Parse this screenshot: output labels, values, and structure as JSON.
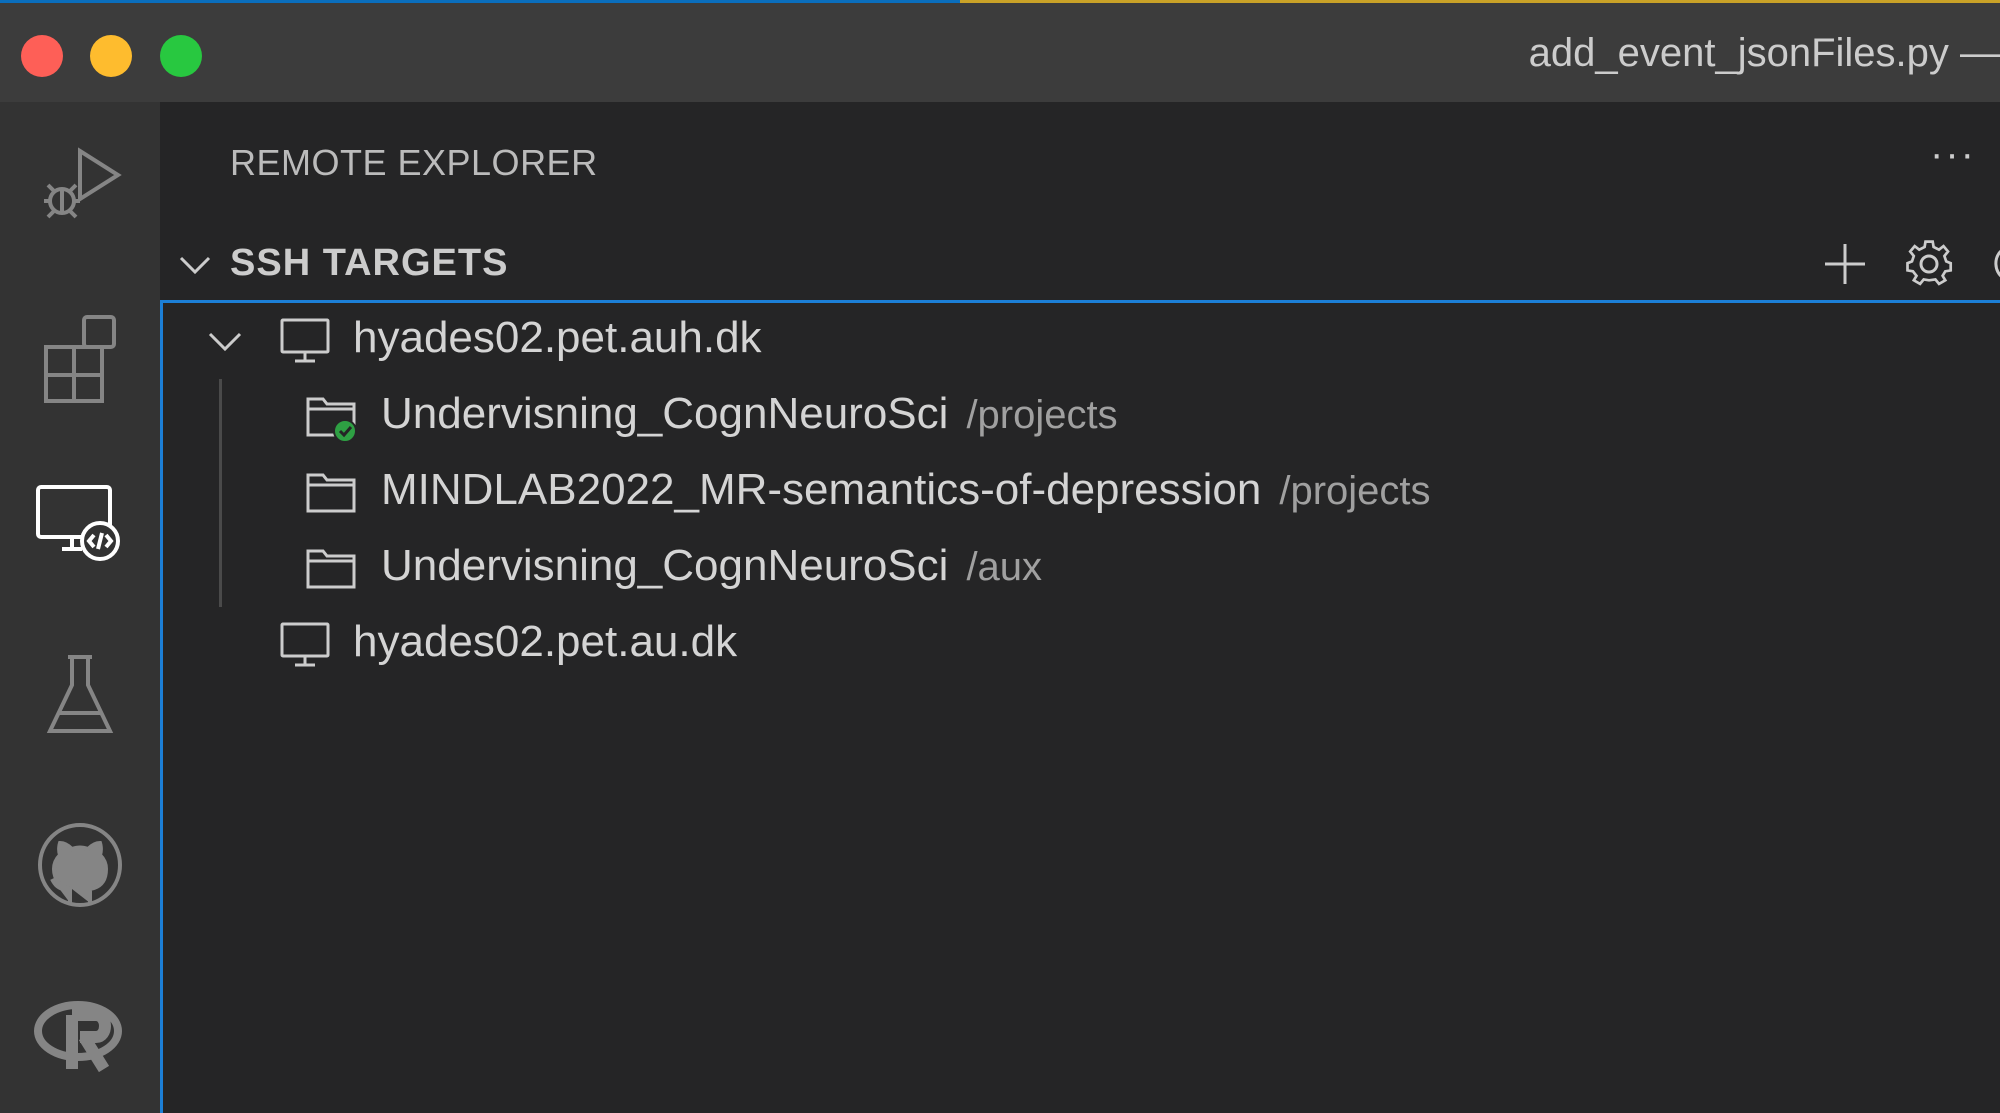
{
  "window": {
    "title": "add_event_jsonFiles.py —"
  },
  "activity_bar": {
    "items": [
      {
        "name": "Run and Debug",
        "icon": "run-debug-icon",
        "active": false
      },
      {
        "name": "Extensions",
        "icon": "extensions-icon",
        "active": false
      },
      {
        "name": "Remote Explorer",
        "icon": "remote-explorer-icon",
        "active": true
      },
      {
        "name": "Testing",
        "icon": "flask-icon",
        "active": false
      },
      {
        "name": "GitHub",
        "icon": "github-icon",
        "active": false
      },
      {
        "name": "R",
        "icon": "r-icon",
        "active": false
      }
    ]
  },
  "sidebar": {
    "title": "REMOTE EXPLORER",
    "more_actions": "···",
    "section": {
      "title": "SSH TARGETS",
      "actions": [
        "plus-icon",
        "gear-icon",
        "refresh-icon"
      ]
    },
    "tree": [
      {
        "host": "hyades02.pet.auh.dk",
        "expanded": true,
        "folders": [
          {
            "name": "Undervisning_CognNeuroSci",
            "path": "/projects",
            "connected": true
          },
          {
            "name": "MINDLAB2022_MR-semantics-of-depression",
            "path": "/projects",
            "connected": false
          },
          {
            "name": "Undervisning_CognNeuroSci",
            "path": "/aux",
            "connected": false
          }
        ]
      },
      {
        "host": "hyades02.pet.au.dk",
        "expanded": false,
        "folders": []
      }
    ]
  },
  "colors": {
    "accent": "#1c7fd6",
    "connected": "#2ea043",
    "close": "#fe5f57",
    "minimize": "#febc2e",
    "maximize": "#28c840"
  }
}
